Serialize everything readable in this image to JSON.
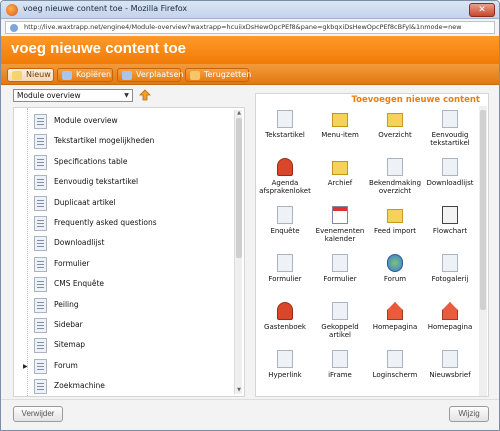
{
  "window": {
    "title": "voeg nieuwe content toe - Mozilla Firefox",
    "url": "http://live.waxtrapp.net/engine4/Module-overview?waxtrapp=hcuiixDsHewOpcPEf8&pane=gkbqxiDsHewOpcPEf8cBFyl&1nmode=new"
  },
  "header": {
    "title": "voeg nieuwe content toe"
  },
  "tabs": [
    {
      "label": "Nieuw",
      "icon": "new-icon",
      "color": "#f5d46a"
    },
    {
      "label": "Kopiëren",
      "icon": "copy-icon",
      "color": "#a8c6ec"
    },
    {
      "label": "Verplaatsen",
      "icon": "move-icon",
      "color": "#a8c6ec"
    },
    {
      "label": "Terugzetten",
      "icon": "undo-icon",
      "color": "#f6c56a"
    }
  ],
  "left": {
    "select_value": "Module overview",
    "items": [
      "Module overview",
      "Tekstartikel mogelijkheden",
      "Specifications table",
      "Eenvoudig tekstartikel",
      "Duplicaat artikel",
      "Frequently asked questions",
      "Downloadlijst",
      "Formulier",
      "CMS Enquête",
      "Peiling",
      "Sidebar",
      "Sitemap",
      "Forum",
      "Zoekmachine"
    ]
  },
  "right": {
    "title": "Toevoegen nieuwe content",
    "items": [
      {
        "label": "Tekstartikel",
        "icon": "doc-icon"
      },
      {
        "label": "Menu-item",
        "icon": "folder-icon"
      },
      {
        "label": "Overzicht",
        "icon": "folder-icon"
      },
      {
        "label": "Eenvoudig tekstartikel",
        "icon": "doc-icon"
      },
      {
        "label": "Agenda afsprakenloket",
        "icon": "person-icon"
      },
      {
        "label": "Archief",
        "icon": "folder-icon"
      },
      {
        "label": "Bekendmaking overzicht",
        "icon": "doc-icon"
      },
      {
        "label": "Downloadlijst",
        "icon": "doc-icon"
      },
      {
        "label": "Enquête",
        "icon": "doc-icon"
      },
      {
        "label": "Evenementen kalender",
        "icon": "calendar-icon"
      },
      {
        "label": "Feed import",
        "icon": "folder-icon"
      },
      {
        "label": "Flowchart",
        "icon": "flowchart-icon"
      },
      {
        "label": "Formulier",
        "icon": "doc-icon"
      },
      {
        "label": "Formulier",
        "icon": "doc-icon"
      },
      {
        "label": "Forum",
        "icon": "globe-icon"
      },
      {
        "label": "Fotogalerij",
        "icon": "doc-icon"
      },
      {
        "label": "Gastenboek",
        "icon": "person-icon"
      },
      {
        "label": "Gekoppeld artikel",
        "icon": "doc-icon"
      },
      {
        "label": "Homepagina",
        "icon": "house-icon"
      },
      {
        "label": "Homepagina",
        "icon": "house-icon"
      },
      {
        "label": "Hyperlink",
        "icon": "doc-icon"
      },
      {
        "label": "iFrame",
        "icon": "doc-icon"
      },
      {
        "label": "Loginscherm",
        "icon": "doc-icon"
      },
      {
        "label": "Nieuwsbrief",
        "icon": "doc-icon"
      }
    ]
  },
  "footer": {
    "left_button": "Verwijder",
    "right_button": "Wijzig"
  },
  "colors": {
    "accent": "#f27a06",
    "section_title": "#f07d10"
  }
}
